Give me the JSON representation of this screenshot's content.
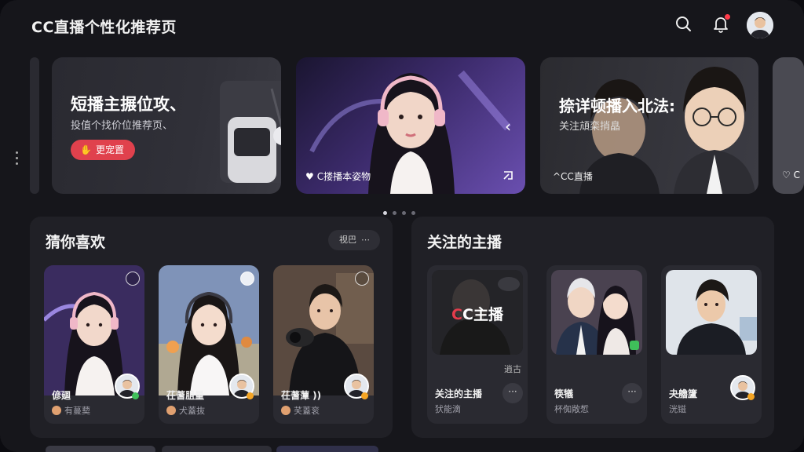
{
  "app": {
    "title": "CC直播个性化推荐页"
  },
  "header": {
    "search_icon": "search-icon",
    "bell_icon": "bell-icon",
    "avatar": "avatar"
  },
  "banners": [
    {
      "title": "短播主搌位攻、",
      "subtitle": "投值个找价位推荐页、",
      "button": "更宠置"
    },
    {
      "caption": "C搂播本姿物",
      "heart": "♥"
    },
    {
      "title": "捺详顿播入北法:",
      "subtitle": "关注頏栾捎皛",
      "caption": "^CC直播"
    },
    {
      "caption": "♡ C"
    }
  ],
  "carousel": {
    "count": 4,
    "active": 0
  },
  "guess": {
    "title": "猜你喜欢",
    "more_label": "视巴",
    "more_icon": "⋯",
    "cards": [
      {
        "name": "偐廽",
        "sub": "有蔓葜",
        "status_color": "#3fbf5a"
      },
      {
        "name": "茌蓍䏣量",
        "sub": "犬蓋抜",
        "status_color": "#f5a524"
      },
      {
        "name": "茌蓍藫 ))",
        "sub": "芺蓋衮",
        "status_color": "#f5a524"
      }
    ]
  },
  "follow": {
    "title": "关注的主播",
    "cards": [
      {
        "overlay": "CCC主播",
        "overlay_red": "C",
        "overlay_rest": "C主播",
        "live_tag": "逍古",
        "name": "关注的主播",
        "sub": "犾能滴",
        "more": "···"
      },
      {
        "name": "筷犠",
        "sub": "杯倁敞惁",
        "more": "···"
      },
      {
        "name": "夬艪籚",
        "sub": "洸镃"
      }
    ]
  },
  "colors": {
    "accent": "#e0414d",
    "notification": "#ff3b4a",
    "online": "#3fbf5a",
    "badge": "#f5a524"
  }
}
